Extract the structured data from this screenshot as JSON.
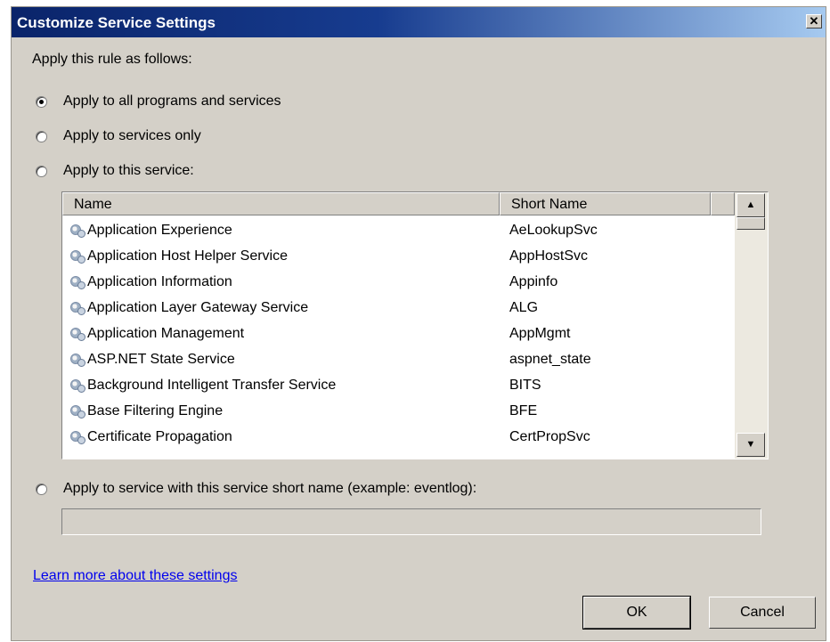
{
  "window": {
    "title": "Customize Service Settings",
    "close_glyph": "✕"
  },
  "intro_label": "Apply this rule as follows:",
  "options": {
    "all": "Apply to all programs and services",
    "services_only": "Apply to services only",
    "this_service": "Apply to this service:",
    "short_name": "Apply to service with this service short name (example: eventlog):"
  },
  "selected_option": "all",
  "list": {
    "columns": {
      "name": "Name",
      "short_name": "Short Name"
    },
    "rows": [
      {
        "name": "Application Experience",
        "short": "AeLookupSvc"
      },
      {
        "name": "Application Host Helper Service",
        "short": "AppHostSvc"
      },
      {
        "name": "Application Information",
        "short": "Appinfo"
      },
      {
        "name": "Application Layer Gateway Service",
        "short": "ALG"
      },
      {
        "name": "Application Management",
        "short": "AppMgmt"
      },
      {
        "name": "ASP.NET State Service",
        "short": "aspnet_state"
      },
      {
        "name": "Background Intelligent Transfer Service",
        "short": "BITS"
      },
      {
        "name": "Base Filtering Engine",
        "short": "BFE"
      },
      {
        "name": "Certificate Propagation",
        "short": "CertPropSvc"
      }
    ],
    "row_icon": "service-gears-icon"
  },
  "short_name_input": {
    "value": ""
  },
  "learn_more_link": "Learn more about these settings",
  "buttons": {
    "ok": "OK",
    "cancel": "Cancel"
  }
}
